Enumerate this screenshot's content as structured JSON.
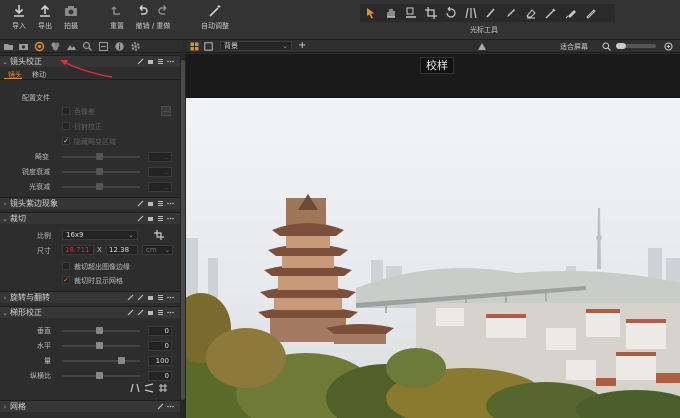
{
  "toolbar": {
    "import_label": "导入",
    "export_label": "导出",
    "capture_label": "拍摄",
    "reset_label": "重置",
    "undo_redo_label": "撤销 / 重做",
    "auto_adjust_label": "自动调整",
    "cursor_tools_label": "光标工具"
  },
  "viewer_bar": {
    "background_select": "背景",
    "fit_screen_label": "适合屏幕"
  },
  "viewer": {
    "caption": "校样"
  },
  "lens": {
    "title": "镜头校正",
    "tab_lens": "镜头",
    "tab_move": "移动",
    "profile_label": "配置文件",
    "chromatic_label": "色像差",
    "diffraction_label": "衍射校正",
    "hide_distorted_label": "隐藏畸变区域",
    "distortion_label": "畸变",
    "sharpness_falloff_label": "锐度衰减",
    "light_falloff_label": "光衰减"
  },
  "fringing": {
    "title": "镜头紫边现象"
  },
  "crop": {
    "title": "裁切",
    "ratio_label": "比例",
    "ratio_value": "16x9",
    "size_label": "尺寸",
    "width_value": "18.711",
    "x_sep": "X",
    "height_value": "12.38",
    "unit_value": "cm",
    "crop_outside_label": "裁切超出图像边缘",
    "show_mask_label": "裁切时显示网格"
  },
  "rotation": {
    "title": "旋转与翻转"
  },
  "keystone": {
    "title": "梯形校正",
    "vertical_label": "垂直",
    "vertical_value": "0",
    "horizontal_label": "水平",
    "horizontal_value": "0",
    "amount_label": "量",
    "amount_value": "100",
    "aspect_label": "纵横比",
    "aspect_value": "0"
  },
  "grid": {
    "title": "网格"
  },
  "colors": {
    "accent_orange": "#e0902a",
    "callout_red": "#e03030",
    "panel_bg": "#2d2d2d"
  }
}
